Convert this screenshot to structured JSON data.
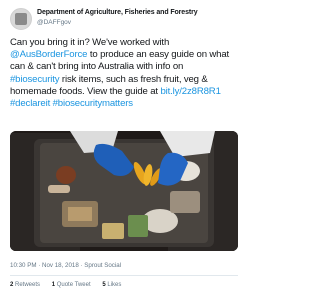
{
  "account": {
    "name": "Department of Agriculture, Fisheries and Forestry",
    "handle": "@DAFFgov"
  },
  "tweet": {
    "l1": "Can you bring it in? We've worked with",
    "l2_mention": "@AusBorderForce",
    "l2_rest": " to produce an easy guide on what",
    "l3": "can & can't bring into Australia with info on",
    "l4_hashtag": "#biosecurity",
    "l4_rest": " risk items, such as fresh fruit, veg &",
    "l5_text": "homemade foods. View the guide at ",
    "l5_link": "bit.ly/2z8R8R1",
    "l6_h1": "#declareit",
    "l6_h2": "#biosecuritymatters"
  },
  "meta": {
    "timestamp": "10:30 PM · Nov 18, 2018 · Sprout Social"
  },
  "stats": {
    "retweets_count": "2",
    "retweets_label": "Retweets",
    "quotes_count": "1",
    "quotes_label": "Quote Tweet",
    "likes_count": "5",
    "likes_label": "Likes"
  },
  "colors": {
    "link": "#1b95e0",
    "secondary_text": "#657786",
    "glove": "#1f5fb8"
  }
}
